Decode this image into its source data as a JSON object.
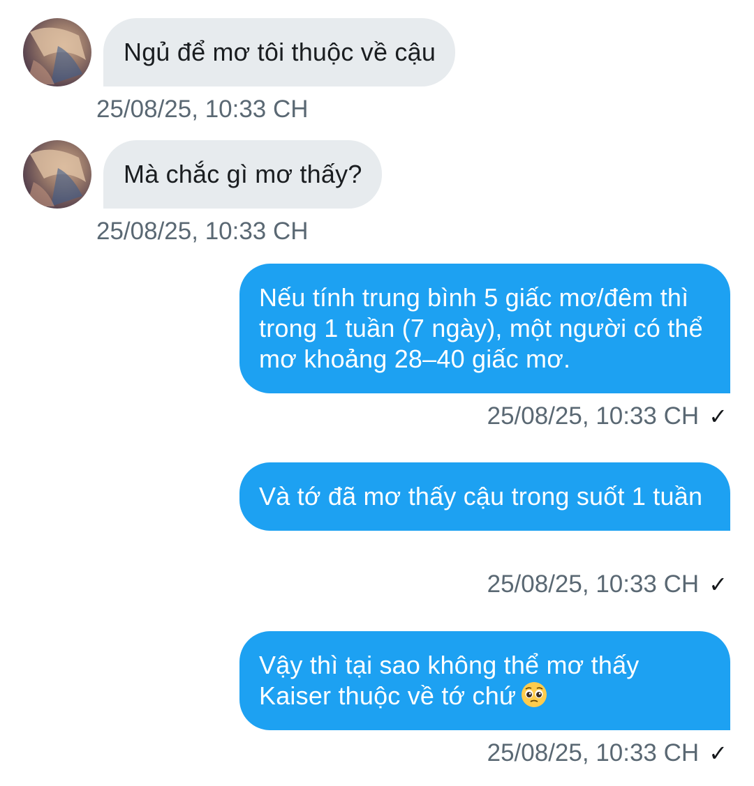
{
  "messages": [
    {
      "direction": "in",
      "text": "Ngủ để mơ tôi thuộc về cậu",
      "time": "25/08/25, 10:33 CH"
    },
    {
      "direction": "in",
      "text": "Mà chắc gì mơ thấy?",
      "time": "25/08/25, 10:33 CH"
    },
    {
      "direction": "out",
      "text": "Nếu tính trung bình 5 giấc mơ/đêm thì trong 1 tuần (7 ngày), một người có thể mơ khoảng 28–40 giấc mơ.",
      "time": "25/08/25, 10:33 CH",
      "status": "✓"
    },
    {
      "direction": "out",
      "text": "Và tớ đã mơ thấy cậu trong suốt 1 tuần",
      "time": "25/08/25, 10:33 CH",
      "status": "✓"
    },
    {
      "direction": "out",
      "text": "Vậy thì tại sao không thể mơ thấy Kaiser thuộc về tớ chứ",
      "emoji": "pleading-face-icon",
      "time": "25/08/25, 10:33 CH",
      "status": "✓"
    }
  ],
  "colors": {
    "outgoing_bubble": "#1da1f2",
    "incoming_bubble": "#e7ebee",
    "timestamp": "#5a6873"
  }
}
